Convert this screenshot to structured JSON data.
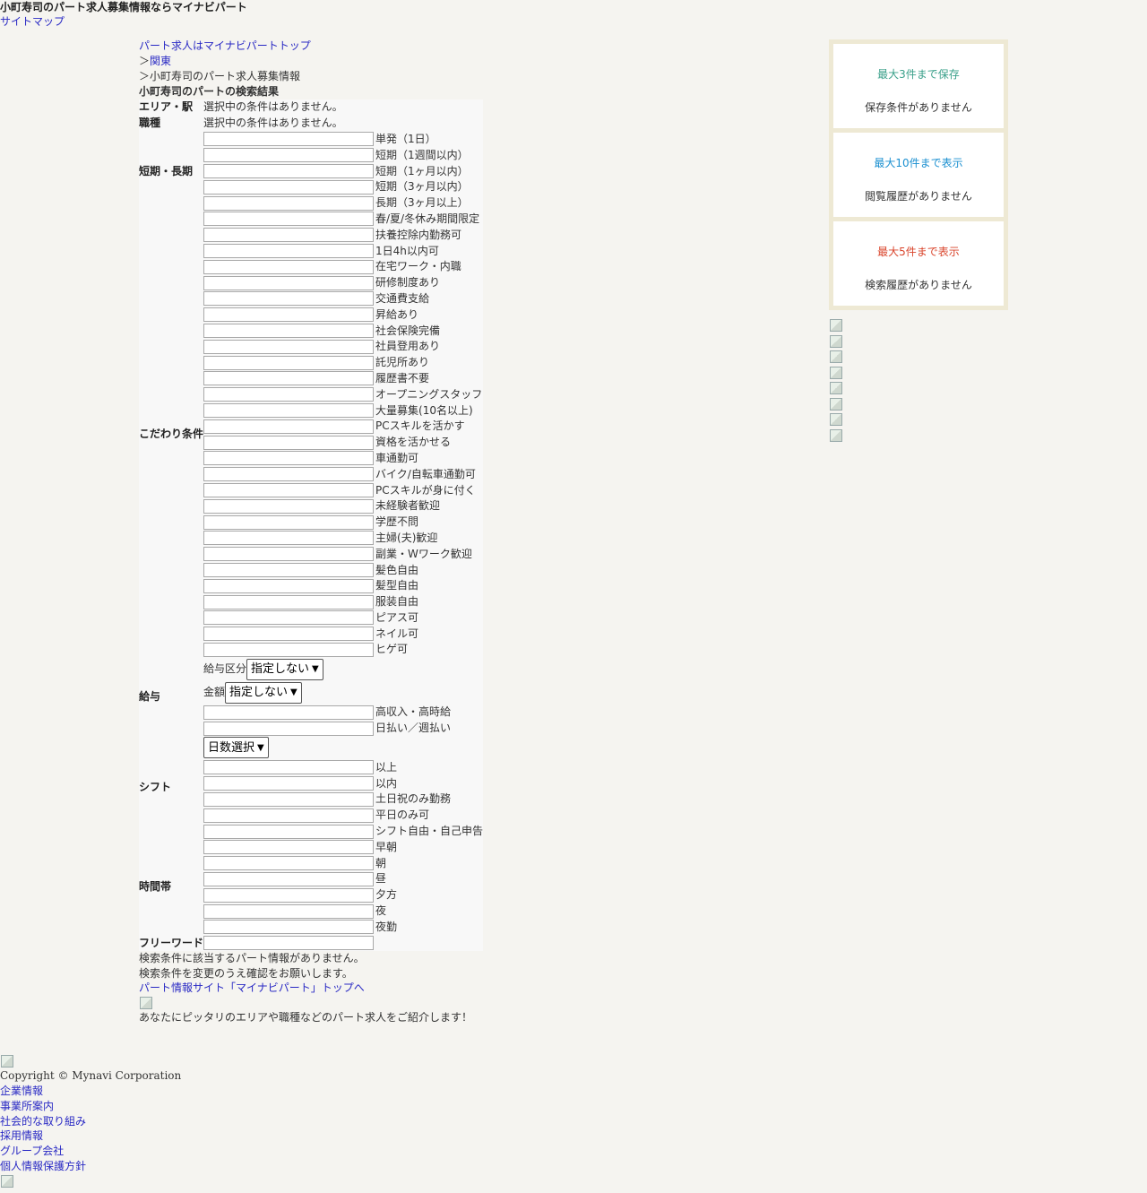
{
  "header": {
    "title": "小町寿司のパート求人募集情報ならマイナビパート",
    "sitemap": "サイトマップ"
  },
  "breadcrumb": {
    "top": "パート求人はマイナビパートトップ",
    "sep": "＞",
    "region": "関東",
    "current": "小町寿司のパート求人募集情報"
  },
  "result_title": "小町寿司のパートの検索結果",
  "conditions": {
    "area_label": "エリア・駅",
    "area_value": "選択中の条件はありません。",
    "job_label": "職種",
    "job_value": "選択中の条件はありません。",
    "term_label": "短期・長期",
    "term_options": [
      "単発（1日）",
      "短期（1週間以内）",
      "短期（1ヶ月以内）",
      "短期（3ヶ月以内）",
      "長期（3ヶ月以上）"
    ],
    "kodawari_label": "こだわり条件",
    "kodawari_options": [
      "春/夏/冬休み期間限定",
      "扶養控除内勤務可",
      "1日4h以内可",
      "在宅ワーク・内職",
      "研修制度あり",
      "交通費支給",
      "昇給あり",
      "社会保険完備",
      "社員登用あり",
      "託児所あり",
      "履歴書不要",
      "オープニングスタッフ",
      "大量募集(10名以上)",
      "PCスキルを活かす",
      "資格を活かせる",
      "車通勤可",
      "バイク/自転車通勤可",
      "PCスキルが身に付く",
      "未経験者歓迎",
      "学歴不問",
      "主婦(夫)歓迎",
      "副業・Wワーク歓迎",
      "髪色自由",
      "髪型自由",
      "服装自由",
      "ピアス可",
      "ネイル可",
      "ヒゲ可"
    ],
    "salary_label": "給与",
    "salary_type_label": "給与区分",
    "salary_type_value": "指定しない",
    "amount_label": "金額",
    "amount_value": "指定しない",
    "salary_options": [
      "高収入・高時給",
      "日払い／週払い"
    ],
    "shift_label": "シフト",
    "days_select": "日数選択",
    "shift_options": [
      "以上",
      "以内",
      "土日祝のみ勤務",
      "平日のみ可",
      "シフト自由・自己申告"
    ],
    "time_label": "時間帯",
    "time_options": [
      "早朝",
      "朝",
      "昼",
      "夕方",
      "夜",
      "夜勤"
    ],
    "freeword_label": "フリーワード"
  },
  "messages": {
    "no_results": "検索条件に該当するパート情報がありません。",
    "change_request": "検索条件を変更のうえ確認をお願いします。",
    "top_link": "パート情報サイト「マイナビパート」トップへ",
    "intro": "あなたにピッタリのエリアや職種などのパート求人をご紹介します！"
  },
  "sidebar": {
    "saved_title": "最大3件まで保存",
    "saved_text": "保存条件がありません",
    "history_title": "最大10件まで表示",
    "history_text": "閲覧履歴がありません",
    "search_title": "最大5件まで表示",
    "search_text": "検索履歴がありません",
    "colors": {
      "saved": "#3aa08a",
      "history": "#1a8fd0",
      "search": "#d9442b",
      "panel": "#eee9d4"
    }
  },
  "footer": {
    "copyright": "Copyright © Mynavi Corporation",
    "links": [
      "企業情報",
      "事業所案内",
      "社会的な取り組み",
      "採用情報",
      "グループ会社",
      "個人情報保護方針"
    ]
  }
}
